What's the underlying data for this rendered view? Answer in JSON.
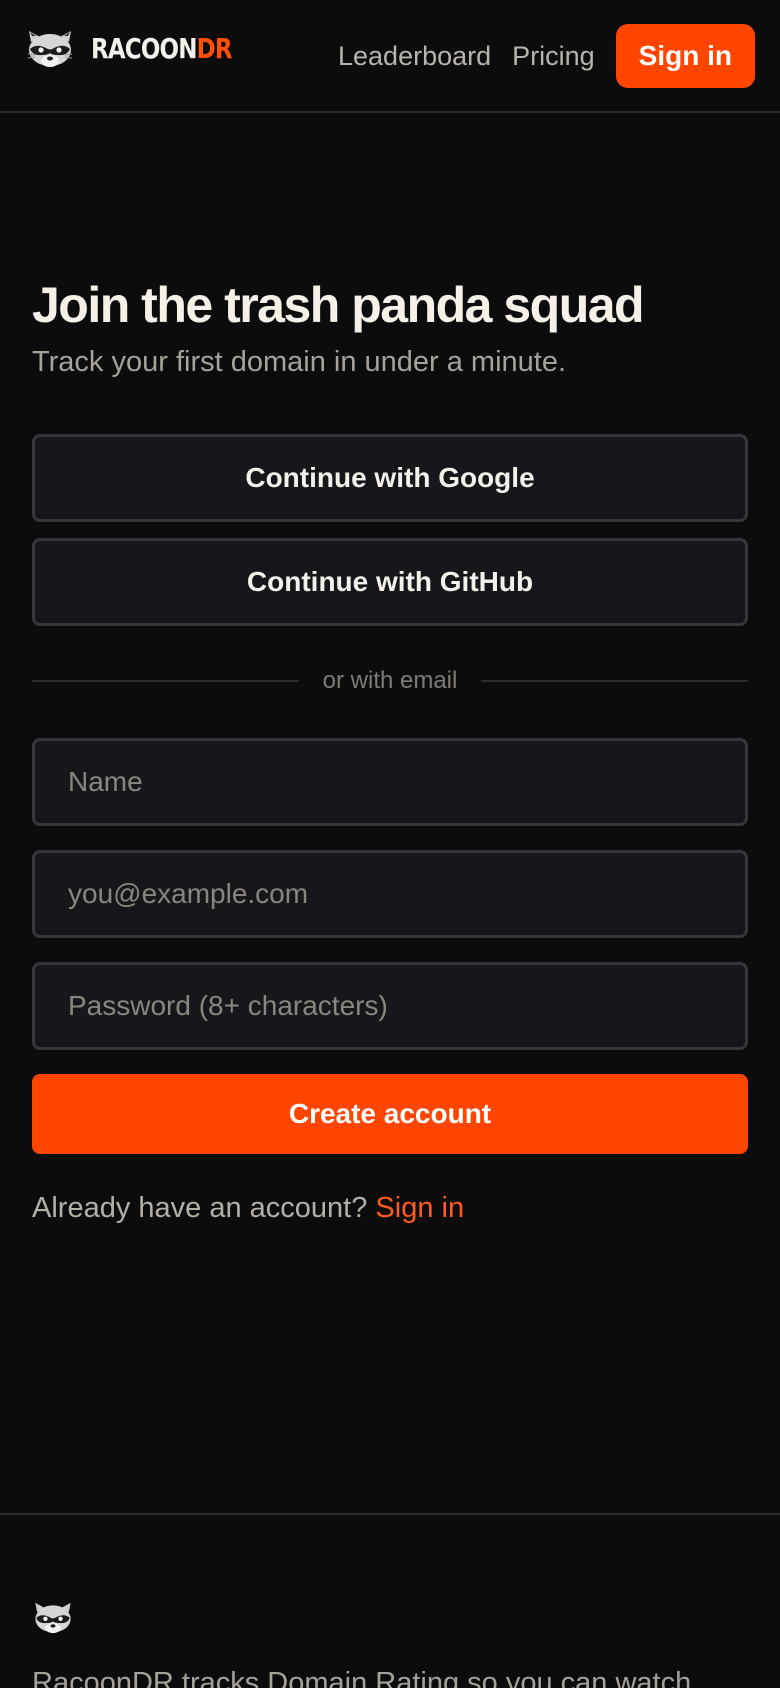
{
  "header": {
    "brand_primary": "RACOON",
    "brand_accent": "DR",
    "nav": {
      "leaderboard": "Leaderboard",
      "pricing": "Pricing",
      "signin": "Sign in"
    }
  },
  "main": {
    "heading": "Join the trash panda squad",
    "subheading": "Track your first domain in under a minute.",
    "oauth": {
      "google": "Continue with Google",
      "github": "Continue with GitHub"
    },
    "divider": "or with email",
    "fields": {
      "name_placeholder": "Name",
      "email_placeholder": "you@example.com",
      "password_placeholder": "Password (8+ characters)"
    },
    "create_account": "Create account",
    "already_text": "Already have an account?",
    "signin_link": "Sign in"
  },
  "footer": {
    "tagline": "RacoonDR tracks Domain Rating so you can watch"
  },
  "icons": {
    "brand_logo": "raccoon-icon",
    "footer_logo": "raccoon-icon"
  },
  "colors": {
    "accent": "#ff4500",
    "background": "#0c0c0d",
    "surface": "#17171b",
    "border": "#36363c"
  }
}
